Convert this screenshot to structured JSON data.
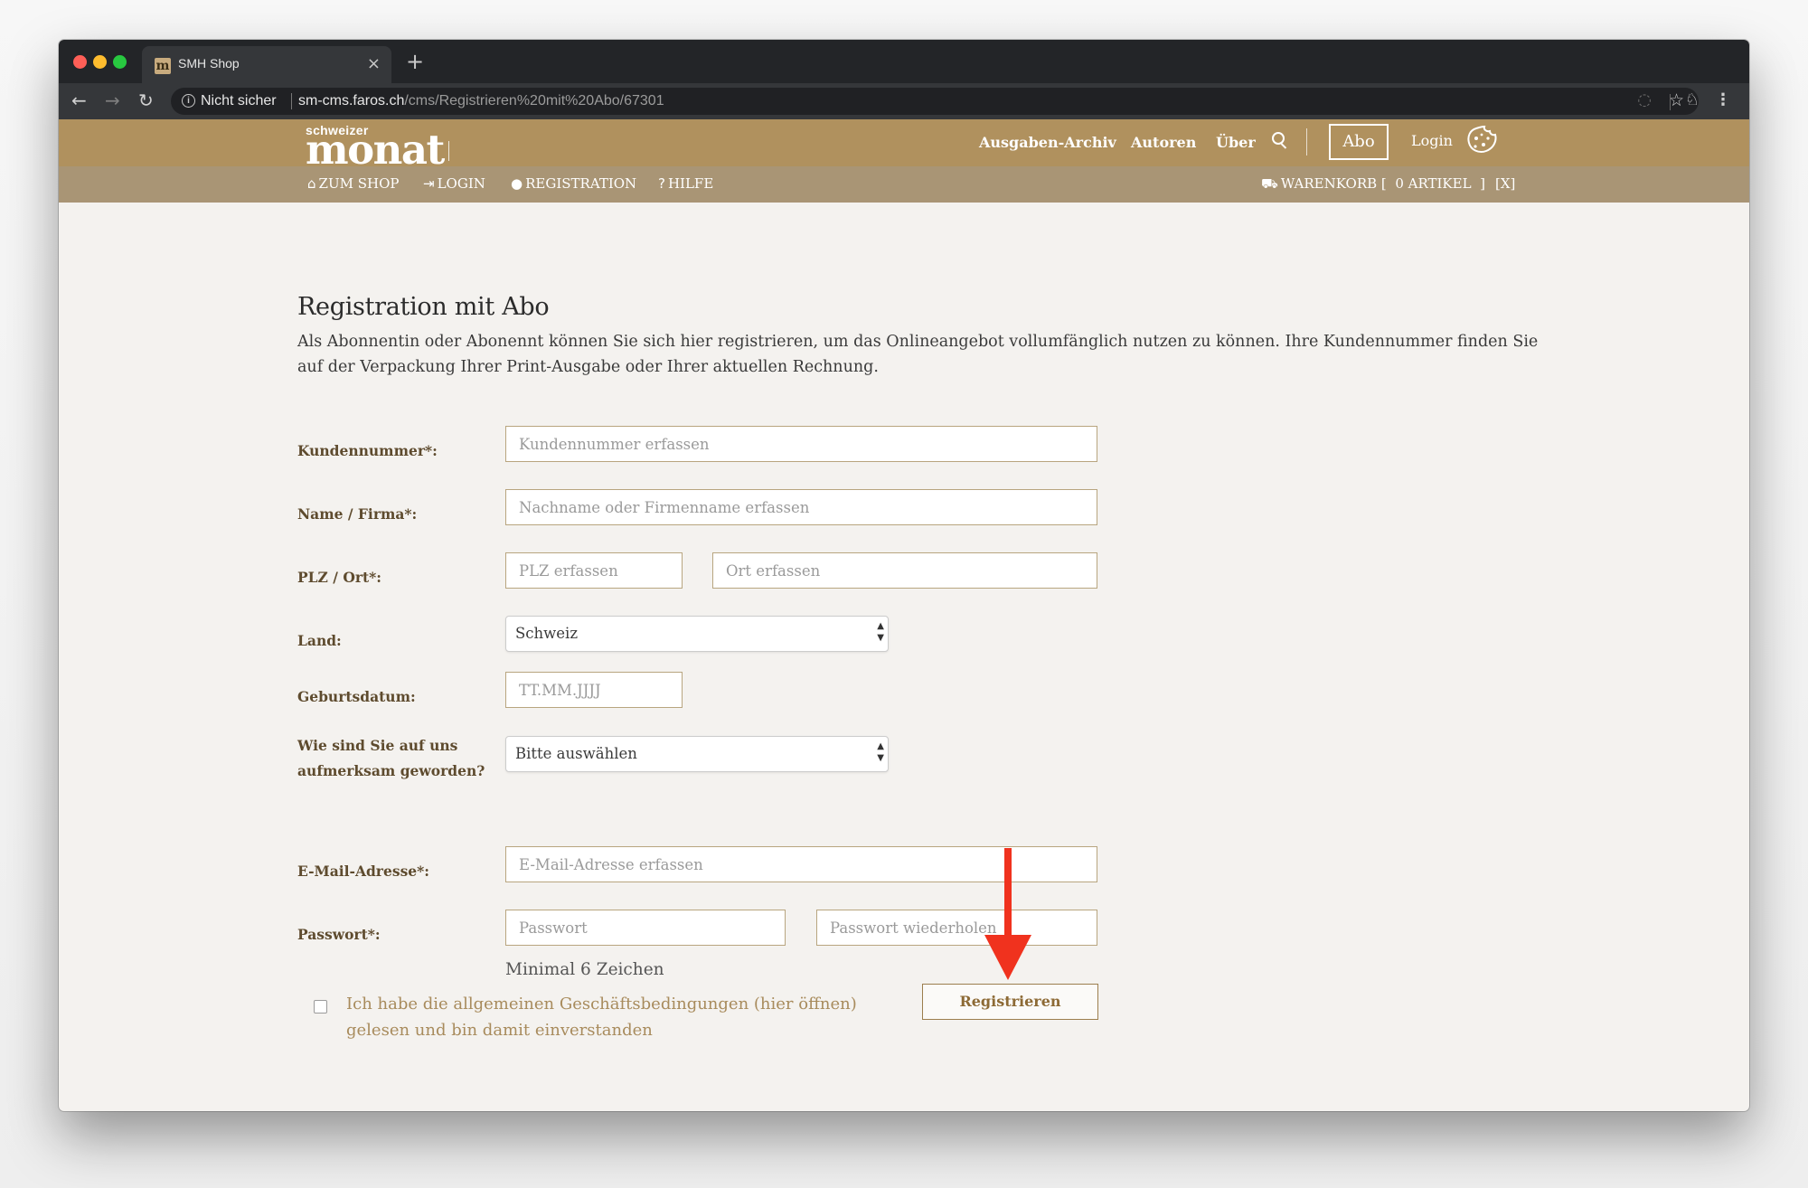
{
  "browser": {
    "tab_title": "SMH Shop",
    "tab_favicon": "m",
    "tab_close": "×",
    "new_tab": "+",
    "security_label": "Nicht sicher",
    "url_host": "sm-cms.faros.ch",
    "url_path": "/cms/Registrieren%20mit%20Abo/67301",
    "icons": [
      "back-arrow-icon",
      "forward-arrow-icon",
      "reload-icon",
      "info-icon",
      "star-icon",
      "extension-icon",
      "incognito-icon",
      "menu-dots-icon"
    ]
  },
  "site": {
    "logo_small": "schweizer",
    "logo_big": "monat",
    "brand_color": "#b0915e",
    "subnav_color": "#a99575",
    "top_nav": {
      "archiv": "Ausgaben-Archiv",
      "autoren": "Autoren",
      "ueber": "Über",
      "abo": "Abo",
      "login": "Login"
    },
    "sub_nav": {
      "shop": "ZUM SHOP",
      "login": "LOGIN",
      "registration": "REGISTRATION",
      "hilfe": "HILFE",
      "cart": "WARENKORB [  0 ARTIKEL  ]",
      "close": "[X]"
    }
  },
  "form": {
    "title": "Registration mit Abo",
    "intro": "Als Abonnentin oder Abonennt können Sie sich hier registrieren, um das Onlineangebot vollumfänglich nutzen zu können. Ihre Kundennummer finden Sie auf der Verpackung Ihrer Print-Ausgabe oder Ihrer aktuellen Rechnung.",
    "labels": {
      "kundennummer": "Kundennummer*:",
      "name": "Name / Firma*:",
      "plz_ort": "PLZ / Ort*:",
      "land": "Land:",
      "geburtsdatum": "Geburtsdatum:",
      "aufmerksam": "Wie sind Sie auf uns aufmerksam geworden?",
      "email": "E-Mail-Adresse*:",
      "passwort": "Passwort*:"
    },
    "placeholders": {
      "kundennummer": "Kundennummer erfassen",
      "name": "Nachname oder Firmenname erfassen",
      "plz": "PLZ erfassen",
      "ort": "Ort erfassen",
      "geburtsdatum": "TT.MM.JJJJ",
      "email": "E-Mail-Adresse erfassen",
      "passwort": "Passwort",
      "passwort2": "Passwort wiederholen"
    },
    "land_selected": "Schweiz",
    "aufmerksam_selected": "Bitte auswählen",
    "password_hint": "Minimal 6 Zeichen",
    "agb_text": "Ich habe die allgemeinen Geschäftsbedingungen (hier öffnen) gelesen und bin damit einverstanden",
    "agb_checked": false,
    "submit_label": "Registrieren"
  },
  "annotation": {
    "arrow_color": "#f0321e"
  }
}
